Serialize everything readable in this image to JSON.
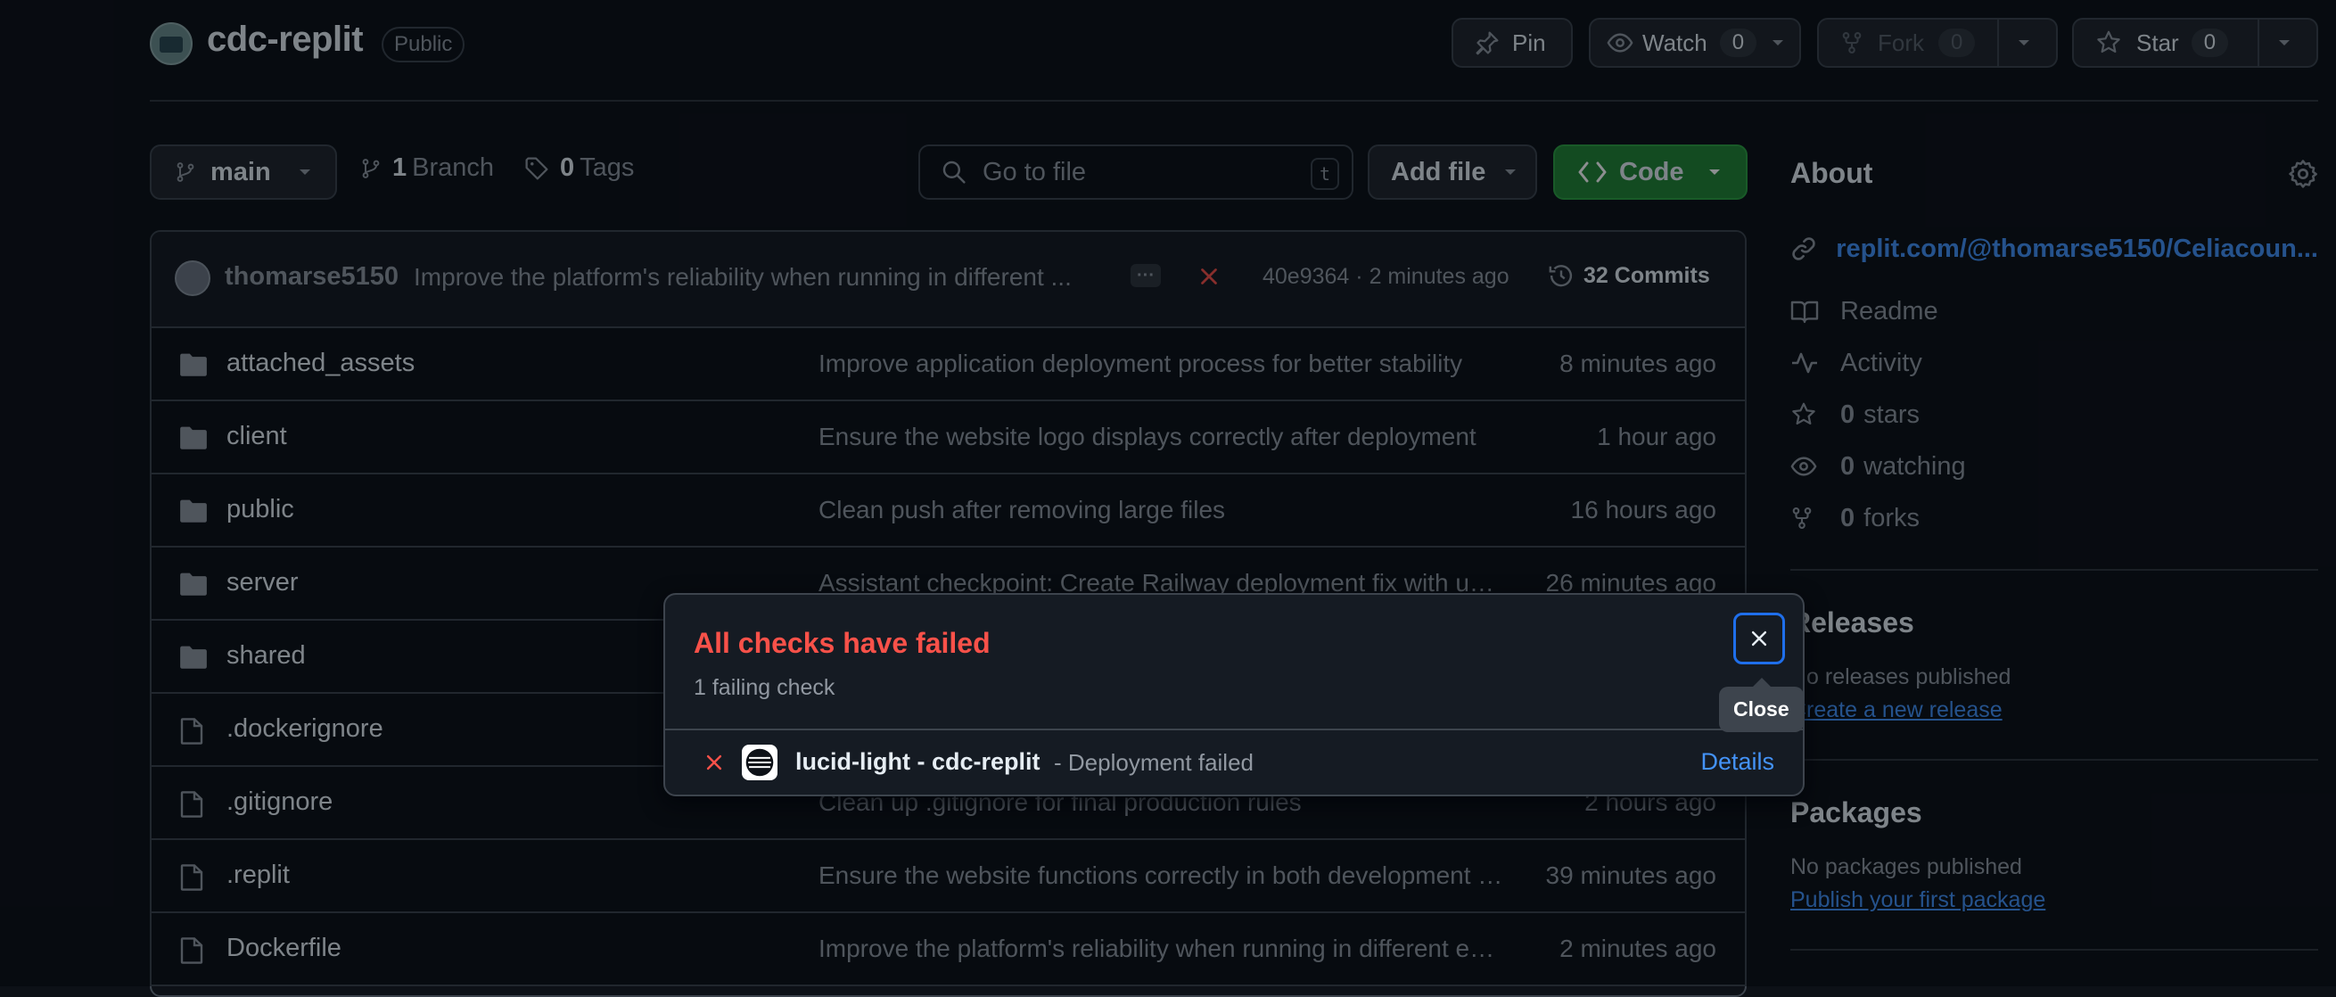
{
  "repo": {
    "name": "cdc-replit",
    "visibility": "Public"
  },
  "header_actions": {
    "pin": "Pin",
    "watch": "Watch",
    "watch_count": "0",
    "fork": "Fork",
    "fork_count": "0",
    "star": "Star",
    "star_count": "0"
  },
  "toolbar": {
    "branch": "main",
    "branches_count": "1",
    "branches_label": "Branch",
    "tags_count": "0",
    "tags_label": "Tags",
    "search_placeholder": "Go to file",
    "search_shortcut": "t",
    "add_file": "Add file",
    "code": "Code"
  },
  "latest_commit": {
    "author": "thomarse5150",
    "message": "Improve the platform's reliability when running in different ...",
    "sha": "40e9364",
    "sep": "·",
    "time": "2 minutes ago",
    "commits_count": "32",
    "commits_label": "Commits"
  },
  "files": [
    {
      "type": "dir",
      "name": "attached_assets",
      "message": "Improve application deployment process for better stability",
      "time": "8 minutes ago"
    },
    {
      "type": "dir",
      "name": "client",
      "message": "Ensure the website logo displays correctly after deployment",
      "time": "1 hour ago"
    },
    {
      "type": "dir",
      "name": "public",
      "message": "Clean push after removing large files",
      "time": "16 hours ago"
    },
    {
      "type": "dir",
      "name": "server",
      "message": "Assistant checkpoint: Create Railway deployment fix with updated configuration",
      "time": "26 minutes ago"
    },
    {
      "type": "dir",
      "name": "shared",
      "message": "",
      "time": ""
    },
    {
      "type": "file",
      "name": ".dockerignore",
      "message": "",
      "time": ""
    },
    {
      "type": "file",
      "name": ".gitignore",
      "message": "Clean up .gitignore for final production rules",
      "time": "2 hours ago"
    },
    {
      "type": "file",
      "name": ".replit",
      "message": "Ensure the website functions correctly in both development and production",
      "time": "39 minutes ago"
    },
    {
      "type": "file",
      "name": "Dockerfile",
      "message": "Improve the platform's reliability when running in different environments",
      "time": "2 minutes ago"
    }
  ],
  "about": {
    "title": "About",
    "link": "replit.com/@thomarse5150/Celiacoun...",
    "readme": "Readme",
    "activity": "Activity",
    "stars_count": "0",
    "stars_label": "stars",
    "watching_count": "0",
    "watching_label": "watching",
    "forks_count": "0",
    "forks_label": "forks"
  },
  "releases": {
    "title": "Releases",
    "none": "No releases published",
    "create_link": "Create a new release"
  },
  "packages": {
    "title": "Packages",
    "none": "No packages published",
    "publish_link": "Publish your first package"
  },
  "checks_popover": {
    "title": "All checks have failed",
    "subtitle": "1 failing check",
    "check_name": "lucid-light - cdc-replit",
    "check_status": "- Deployment failed",
    "details": "Details",
    "close_tooltip": "Close"
  },
  "colors": {
    "background": "#0d1117",
    "accent_link": "#4493f8",
    "error": "#f85149",
    "code_button": "#238636"
  }
}
